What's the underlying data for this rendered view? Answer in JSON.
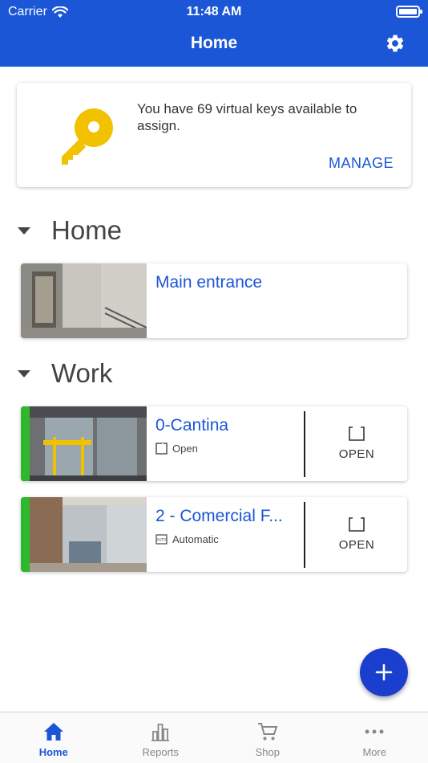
{
  "status_bar": {
    "carrier": "Carrier",
    "time": "11:48 AM"
  },
  "header": {
    "title": "Home",
    "settings_icon": "gear-icon"
  },
  "keys_card": {
    "message": "You have 69 virtual keys available to assign.",
    "action": "MANAGE",
    "icon": "key-icon"
  },
  "sections": [
    {
      "title": "Home",
      "doors": [
        {
          "name": "Main entrance"
        }
      ]
    },
    {
      "title": "Work",
      "doors": [
        {
          "name": "0-Cantina",
          "status": "Open",
          "status_icon": "open-icon",
          "action": "OPEN",
          "indicator_color": "#2eb82e"
        },
        {
          "name": "2 - Comercial F...",
          "status": "Automatic",
          "status_icon": "auto-icon",
          "action": "OPEN",
          "indicator_color": "#2eb82e"
        }
      ]
    }
  ],
  "fab": {
    "icon": "plus-icon"
  },
  "tabbar": [
    {
      "label": "Home",
      "icon": "home-icon",
      "active": true
    },
    {
      "label": "Reports",
      "icon": "bar-chart-icon",
      "active": false
    },
    {
      "label": "Shop",
      "icon": "cart-icon",
      "active": false
    },
    {
      "label": "More",
      "icon": "more-icon",
      "active": false
    }
  ],
  "colors": {
    "primary": "#1a56d6",
    "key": "#f2c200",
    "status_green": "#2eb82e"
  }
}
